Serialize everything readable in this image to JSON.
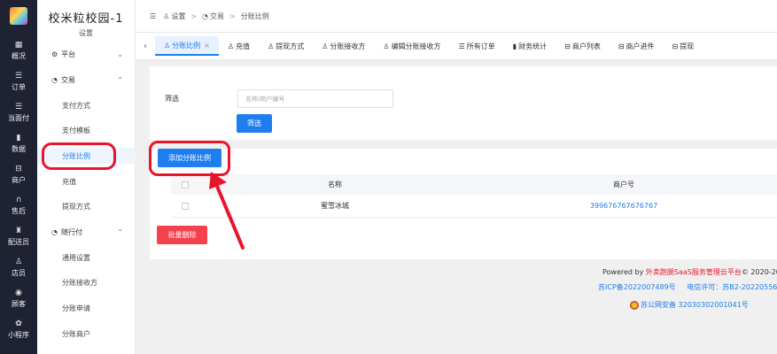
{
  "rail": {
    "items": [
      {
        "label": "概况",
        "icon": "dashboard-icon",
        "glyph": "▦"
      },
      {
        "label": "订单",
        "icon": "list-icon",
        "glyph": "☰"
      },
      {
        "label": "当面付",
        "icon": "list-icon",
        "glyph": "☰"
      },
      {
        "label": "数据",
        "icon": "bar-chart-icon",
        "glyph": "▮"
      },
      {
        "label": "商户",
        "icon": "store-icon",
        "glyph": "⊟"
      },
      {
        "label": "售后",
        "icon": "headset-icon",
        "glyph": "∩"
      },
      {
        "label": "配送员",
        "icon": "rider-icon",
        "glyph": "♜"
      },
      {
        "label": "店员",
        "icon": "user-icon",
        "glyph": "♙"
      },
      {
        "label": "顾客",
        "icon": "customer-icon",
        "glyph": "◉"
      },
      {
        "label": "小程序",
        "icon": "mini-program-icon",
        "glyph": "✿"
      }
    ]
  },
  "menu": {
    "brand": "校米粒校园-1",
    "subtitle": "设置",
    "groups": {
      "platform": "平台",
      "trade": "交易",
      "suixingfu": "随行付"
    },
    "items": {
      "pay_method": "支付方式",
      "pay_template": "支付模板",
      "split_ratio": "分账比例",
      "recharge": "充值",
      "withdraw": "提现方式",
      "general": "通用设置",
      "split_receiver": "分账接收方",
      "split_apply": "分账申请",
      "split_merchant": "分账商户"
    }
  },
  "breadcrumb": {
    "settings": "设置",
    "trade": "交易",
    "current": "分账比例",
    "sep": ">"
  },
  "tabs": [
    {
      "label": "分账比例",
      "active": true
    },
    {
      "label": "充值"
    },
    {
      "label": "提现方式"
    },
    {
      "label": "分账接收方"
    },
    {
      "label": "编辑分账接收方"
    },
    {
      "label": "所有订单"
    },
    {
      "label": "财务统计"
    },
    {
      "label": "商户列表"
    },
    {
      "label": "商户进件"
    },
    {
      "label": "提现"
    }
  ],
  "filter": {
    "label": "筛选",
    "placeholder": "名称/商户编号",
    "button": "筛选"
  },
  "actions": {
    "add": "添加分账比例",
    "batch_delete": "批量删除"
  },
  "table": {
    "headers": [
      "名称",
      "商户号"
    ],
    "rows": [
      {
        "name": "蜜雪冰城",
        "merchant_no": "399676767676767"
      }
    ]
  },
  "footer": {
    "powered_prefix": "Powered by ",
    "powered_brand": "外卖跑腿SaaS服务管理云平台",
    "powered_suffix": "© 2020-20",
    "icp": "苏ICP备2022007489号",
    "telecom": "电信许可：苏B2-20220556",
    "police": "苏公网安备 32030302001041号"
  },
  "colors": {
    "accent": "#1e7ef0",
    "danger": "#f5414e",
    "highlight": "#e8152a",
    "rail_bg": "#1f2233"
  }
}
